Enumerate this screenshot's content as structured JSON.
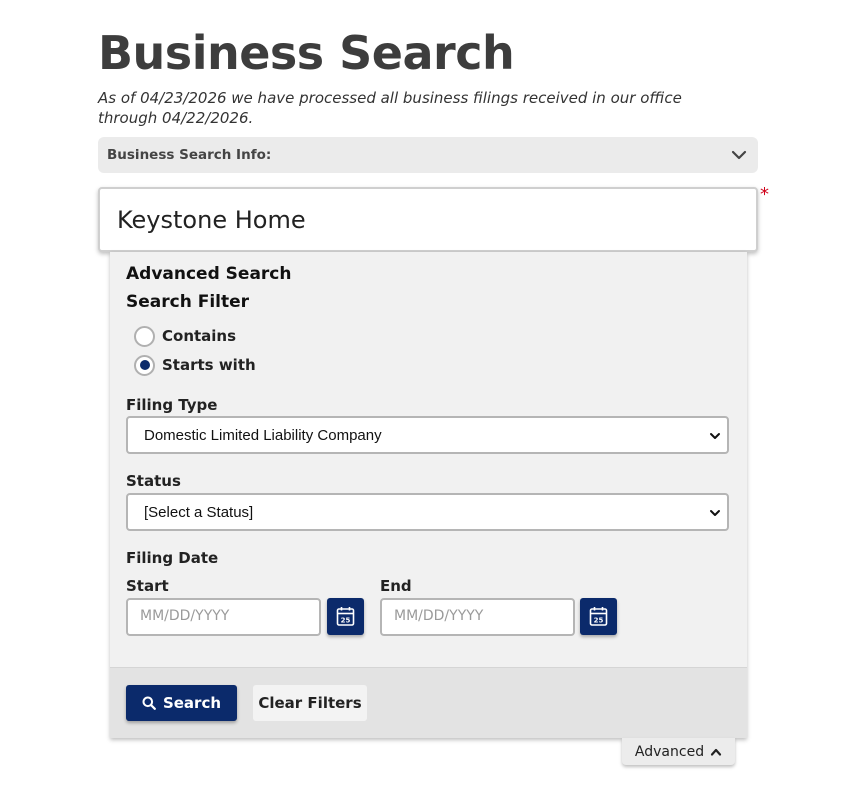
{
  "page": {
    "title": "Business Search",
    "notice": "As of 04/23/2026 we have processed all business filings received in our office through 04/22/2026."
  },
  "info_bar": {
    "label": "Business Search Info:",
    "icon": "chevron-down-icon"
  },
  "search": {
    "value": "Keystone Home",
    "required_marker": "*"
  },
  "advanced": {
    "heading": "Advanced Search",
    "filter_heading": "Search Filter",
    "filter_options": [
      {
        "label": "Contains",
        "checked": false
      },
      {
        "label": "Starts with",
        "checked": true
      }
    ],
    "filing_type": {
      "label": "Filing Type",
      "selected": "Domestic Limited Liability Company"
    },
    "status": {
      "label": "Status",
      "selected": "[Select a Status]"
    },
    "filing_date": {
      "label": "Filing Date",
      "start": {
        "label": "Start",
        "placeholder": "MM/DD/YYYY",
        "icon": "calendar-icon"
      },
      "end": {
        "label": "End",
        "placeholder": "MM/DD/YYYY",
        "icon": "calendar-icon"
      }
    },
    "buttons": {
      "search": "Search",
      "clear": "Clear Filters"
    },
    "toggle": "Advanced"
  },
  "colors": {
    "primary": "#0b2a6b",
    "required": "#d0021b",
    "panel": "#f1f1f1"
  }
}
